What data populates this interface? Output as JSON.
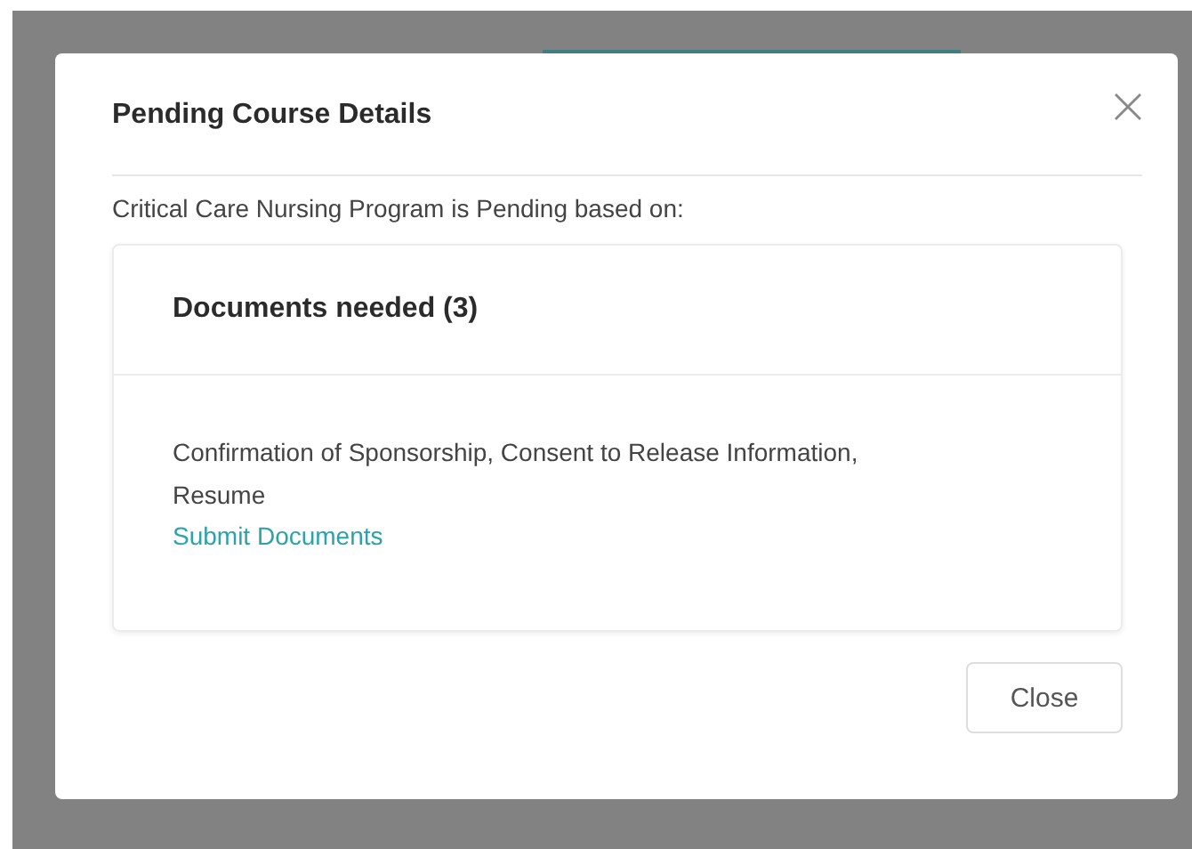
{
  "dialog": {
    "title": "Pending Course Details",
    "intro": "Critical Care Nursing Program is Pending based on:",
    "card": {
      "heading": "Documents needed (3)",
      "body": "Confirmation of Sponsorship, Consent to Release Information, Resume",
      "link": "Submit Documents"
    },
    "buttons": [
      "Close"
    ]
  }
}
